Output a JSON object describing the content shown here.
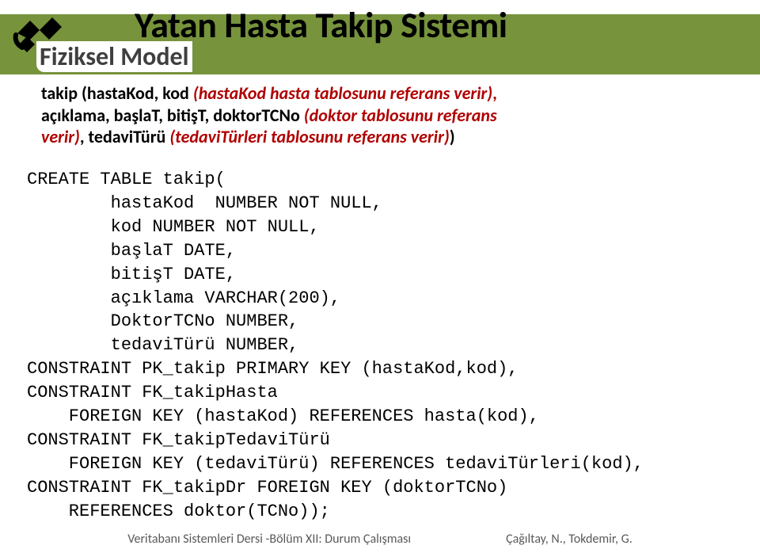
{
  "header": {
    "title": "Yatan Hasta Takip Sistemi",
    "subtitle": "Fiziksel Model"
  },
  "notation": {
    "lead": "takip (hastaKod, kod ",
    "paren1": "(hastaKod hasta tablosunu referans verir)",
    "comma1": ",",
    "line2": "açıklama, başlaT, bitişT, doktorTCNo ",
    "paren2": "(doktor tablosunu referans",
    "line3a": "verir)",
    "mid": ", tedaviTürü ",
    "paren3": "(tedaviTürleri tablosunu referans verir)",
    "close": ")"
  },
  "code": {
    "l1": "CREATE TABLE takip(",
    "l2": "        hastaKod  NUMBER NOT NULL,",
    "l3": "        kod NUMBER NOT NULL,",
    "l4": "        başlaT DATE,",
    "l5": "        bitişT DATE,",
    "l6": "        açıklama VARCHAR(200),",
    "l7": "        DoktorTCNo NUMBER,",
    "l8": "        tedaviTürü NUMBER,",
    "l9": "CONSTRAINT PK_takip PRIMARY KEY (hastaKod,kod),",
    "l10": "CONSTRAINT FK_takipHasta",
    "l11": "    FOREIGN KEY (hastaKod) REFERENCES hasta(kod),",
    "l12": "CONSTRAINT FK_takipTedaviTürü",
    "l13": "    FOREIGN KEY (tedaviTürü) REFERENCES tedaviTürleri(kod),",
    "l14": "CONSTRAINT FK_takipDr FOREIGN KEY (doktorTCNo)",
    "l15": "    REFERENCES doktor(TCNo));"
  },
  "footer": {
    "left": "Veritabanı Sistemleri Dersi  -Bölüm XII: Durum Çalışması",
    "right": "Çağıltay, N., Tokdemir, G."
  }
}
